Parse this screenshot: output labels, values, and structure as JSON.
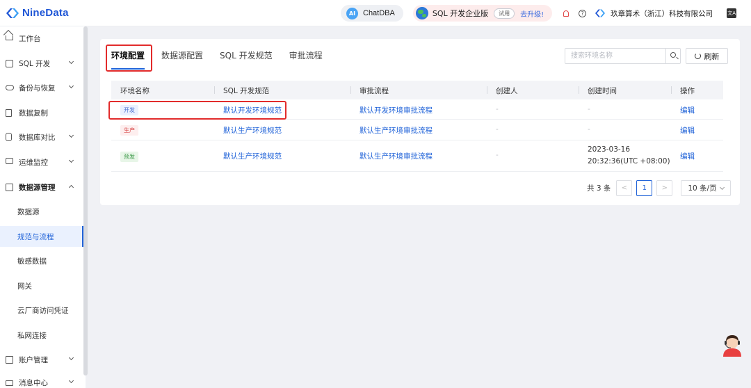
{
  "app": {
    "logo_text": "NineData"
  },
  "topbar": {
    "chatdba_badge": "AI",
    "chatdba_label": "ChatDBA",
    "edition_label": "SQL 开发企业版",
    "trial_label": "试用",
    "upgrade_label": "去升级!",
    "help_glyph": "?",
    "company_name": "玖章算术（浙江）科技有限公司",
    "translate_glyph": "文A"
  },
  "sidebar": {
    "items": [
      {
        "label": "工作台",
        "icon": "home-icon",
        "expandable": false
      },
      {
        "label": "SQL 开发",
        "icon": "sql-icon",
        "expandable": true
      },
      {
        "label": "备份与恢复",
        "icon": "cloud-backup-icon",
        "expandable": true
      },
      {
        "label": "数据复制",
        "icon": "copy-icon",
        "expandable": false
      },
      {
        "label": "数据库对比",
        "icon": "database-icon",
        "expandable": true
      },
      {
        "label": "运维监控",
        "icon": "monitor-icon",
        "expandable": true
      },
      {
        "label": "数据源管理",
        "icon": "datasource-icon",
        "expandable": true,
        "expanded": true
      }
    ],
    "sub_items": [
      {
        "label": "数据源",
        "active": false
      },
      {
        "label": "规范与流程",
        "active": true
      },
      {
        "label": "敏感数据",
        "active": false
      },
      {
        "label": "网关",
        "active": false
      },
      {
        "label": "云厂商访问凭证",
        "active": false
      },
      {
        "label": "私网连接",
        "active": false
      }
    ],
    "bottom_items": [
      {
        "label": "账户管理",
        "icon": "account-icon",
        "expandable": true
      },
      {
        "label": "消息中心",
        "icon": "mail-icon",
        "expandable": true
      }
    ]
  },
  "main": {
    "tabs": [
      {
        "label": "环境配置",
        "active": true
      },
      {
        "label": "数据源配置",
        "active": false
      },
      {
        "label": "SQL 开发规范",
        "active": false
      },
      {
        "label": "审批流程",
        "active": false
      }
    ],
    "search": {
      "placeholder": "搜索环境名称",
      "value": ""
    },
    "refresh_label": "刷新",
    "table": {
      "columns": [
        "环境名称",
        "SQL 开发规范",
        "审批流程",
        "创建人",
        "创建时间",
        "操作"
      ],
      "rows": [
        {
          "env": "开发",
          "env_type": "dev",
          "spec": "默认开发环境规范",
          "flow": "默认开发环境审批流程",
          "creator": "-",
          "created_line1": "-",
          "created_line2": "",
          "action": "编辑"
        },
        {
          "env": "生产",
          "env_type": "prod",
          "spec": "默认生产环境规范",
          "flow": "默认生产环境审批流程",
          "creator": "-",
          "created_line1": "-",
          "created_line2": "",
          "action": "编辑"
        },
        {
          "env": "预发",
          "env_type": "pre",
          "spec": "默认生产环境规范",
          "flow": "默认生产环境审批流程",
          "creator": "-",
          "created_line1": "2023-03-16",
          "created_line2": "20:32:36(UTC +08:00)",
          "action": "编辑"
        }
      ]
    },
    "pagination": {
      "total_label": "共 3 条",
      "prev": "<",
      "current_page": "1",
      "next": ">",
      "page_size": "10 条/页"
    }
  },
  "colors": {
    "accent": "#1f62d8",
    "highlight": "#e22b2b"
  }
}
